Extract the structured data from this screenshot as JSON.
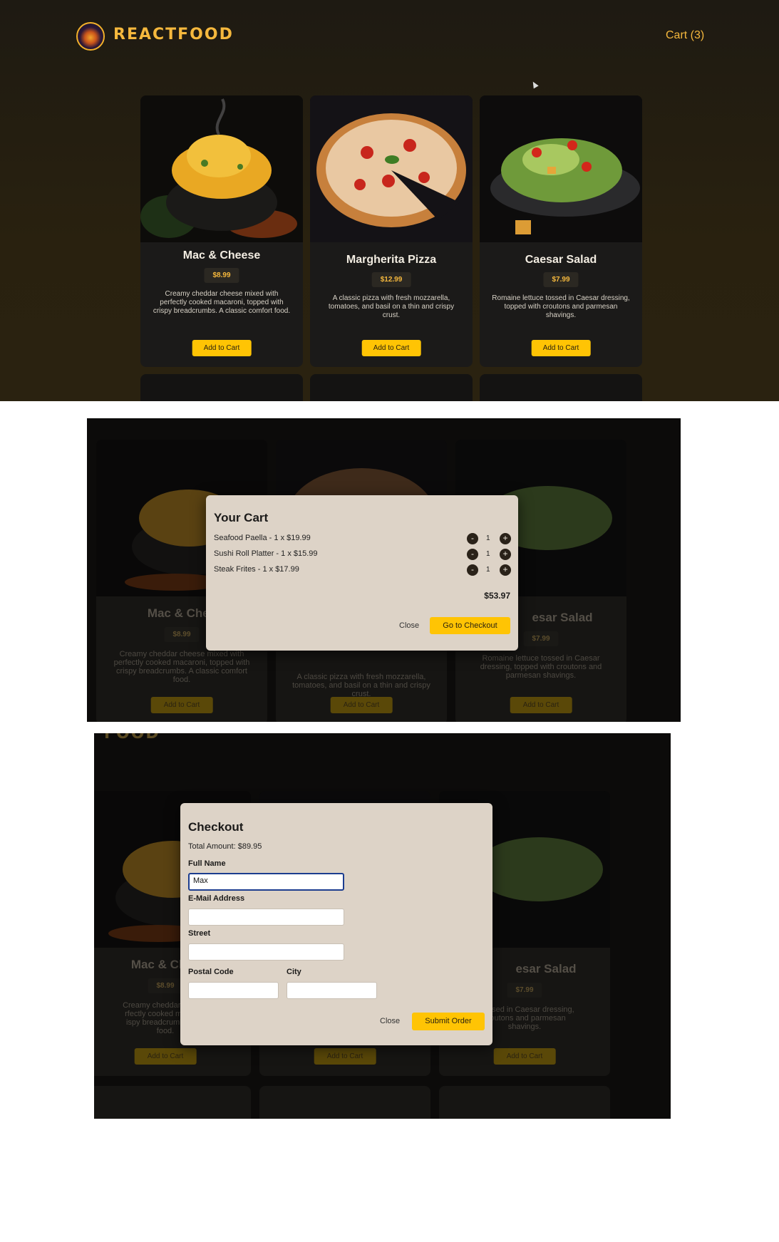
{
  "header": {
    "logo_text": "REACTFOOD",
    "cart_label": "Cart (3)"
  },
  "meals": [
    {
      "name": "Mac & Cheese",
      "price": "$8.99",
      "description": "Creamy cheddar cheese mixed with perfectly cooked macaroni, topped with crispy breadcrumbs. A classic comfort food.",
      "button": "Add to Cart"
    },
    {
      "name": "Margherita Pizza",
      "price": "$12.99",
      "description": "A classic pizza with fresh mozzarella, tomatoes, and basil on a thin and crispy crust.",
      "button": "Add to Cart"
    },
    {
      "name": "Caesar Salad",
      "price": "$7.99",
      "description": "Romaine lettuce tossed in Caesar dressing, topped with croutons and parmesan shavings.",
      "button": "Add to Cart"
    }
  ],
  "bg_cards": {
    "p2": [
      {
        "name": "Mac & Chee",
        "price": "$8.99",
        "description": "Creamy cheddar cheese mixed with perfectly cooked macaroni, topped with crispy breadcrumbs. A classic comfort food.",
        "button": "Add to Cart"
      },
      {
        "name": "",
        "price": "",
        "description": "A classic pizza with fresh mozzarella, tomatoes, and basil on a thin and crispy crust.",
        "button": "Add to Cart"
      },
      {
        "name": "esar Salad",
        "price": "$7.99",
        "description": "Romaine lettuce tossed in Caesar dressing, topped with croutons and parmesan shavings.",
        "button": "Add to Cart"
      }
    ],
    "p3": [
      {
        "name": "Mac & Chee",
        "price": "$8.99",
        "description": "Creamy cheddar cheese\nrfectly cooked macaron\nispy breadcrumbs. A cl\nfood.",
        "button": "Add to Cart"
      },
      {
        "name": "",
        "price": "",
        "description": "",
        "button": "Add to Cart"
      },
      {
        "name": "esar Salad",
        "price": "$7.99",
        "description": "e tossed in Caesar dressing,\ncroutons and parmesan\nshavings.",
        "button": "Add to Cart"
      }
    ],
    "p3_top_fragment": "FOOD"
  },
  "cart_modal": {
    "title": "Your Cart",
    "items": [
      {
        "label": "Seafood Paella - 1 x $19.99",
        "qty": "1"
      },
      {
        "label": "Sushi Roll Platter - 1 x $15.99",
        "qty": "1"
      },
      {
        "label": "Steak Frites - 1 x $17.99",
        "qty": "1"
      }
    ],
    "minus": "-",
    "plus": "+",
    "total": "$53.97",
    "close_label": "Close",
    "checkout_label": "Go to Checkout"
  },
  "checkout_modal": {
    "title": "Checkout",
    "total_text": "Total Amount: $89.95",
    "full_name_label": "Full Name",
    "full_name_value": "Max",
    "email_label": "E-Mail Address",
    "street_label": "Street",
    "postal_label": "Postal Code",
    "city_label": "City",
    "close_label": "Close",
    "submit_label": "Submit Order"
  },
  "colors": {
    "accent": "#ffc404",
    "brand": "#f5b83d",
    "modal_bg": "#ddd3c7",
    "page_bg": "#29210f"
  }
}
